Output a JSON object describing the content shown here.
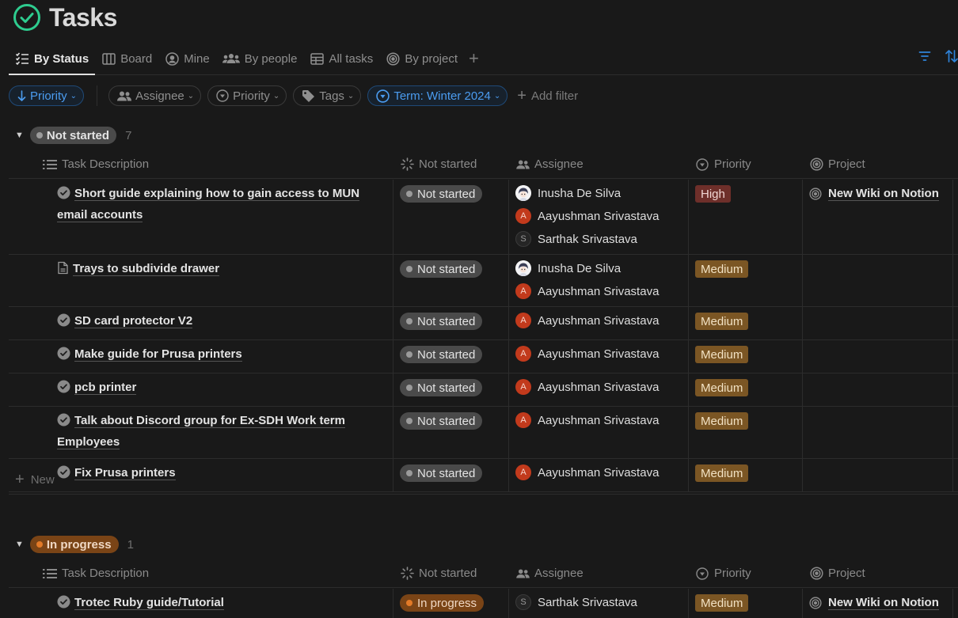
{
  "page": {
    "title": "Tasks",
    "accent": "#2ecc8f"
  },
  "tabs": [
    {
      "label": "By Status",
      "icon": "checklist-icon",
      "active": true
    },
    {
      "label": "Board",
      "icon": "board-icon"
    },
    {
      "label": "Mine",
      "icon": "user-circle-icon"
    },
    {
      "label": "By people",
      "icon": "people-icon"
    },
    {
      "label": "All tasks",
      "icon": "table-icon"
    },
    {
      "label": "By project",
      "icon": "target-icon"
    }
  ],
  "toolbar": {
    "add_view": "+",
    "filter_icon": "filter-icon",
    "sort_icon": "sort-icon"
  },
  "filters": {
    "sort": "Priority",
    "chips": [
      "Assignee",
      "Priority",
      "Tags"
    ],
    "term": "Term: Winter 2024",
    "add_filter": "Add filter"
  },
  "columns": {
    "task": "Task Description",
    "status": "Not started",
    "assignee": "Assignee",
    "priority": "Priority",
    "project": "Project"
  },
  "groups": [
    {
      "label": "Not started",
      "count": "7",
      "rows": [
        {
          "title": "Short guide explaining how to gain access to MUN email accounts",
          "icon": "task-check-icon",
          "status": "Not started",
          "assignees": [
            "Inusha De Silva",
            "Aayushman Srivastava",
            "Sarthak Srivastava"
          ],
          "priority": "High",
          "project": "New Wiki on Notion"
        },
        {
          "title": "Trays to subdivide drawer",
          "icon": "document-icon",
          "status": "Not started",
          "assignees": [
            "Inusha De Silva",
            "Aayushman Srivastava"
          ],
          "priority": "Medium",
          "project": ""
        },
        {
          "title": "SD card protector V2",
          "icon": "task-check-icon",
          "status": "Not started",
          "assignees": [
            "Aayushman Srivastava"
          ],
          "priority": "Medium",
          "project": ""
        },
        {
          "title": "Make guide for Prusa printers",
          "icon": "task-check-icon",
          "status": "Not started",
          "assignees": [
            "Aayushman Srivastava"
          ],
          "priority": "Medium",
          "project": ""
        },
        {
          "title": "pcb printer",
          "icon": "task-check-icon",
          "status": "Not started",
          "assignees": [
            "Aayushman Srivastava"
          ],
          "priority": "Medium",
          "project": ""
        },
        {
          "title": "Talk about Discord group for Ex-SDH Work term Employees",
          "icon": "task-check-icon",
          "status": "Not started",
          "assignees": [
            "Aayushman Srivastava"
          ],
          "priority": "Medium",
          "project": ""
        },
        {
          "title": "Fix Prusa printers",
          "icon": "task-check-icon",
          "status": "Not started",
          "assignees": [
            "Aayushman Srivastava"
          ],
          "priority": "Medium",
          "project": ""
        }
      ],
      "new_label": "New"
    },
    {
      "label": "In progress",
      "count": "1",
      "rows": [
        {
          "title": "Trotec Ruby guide/Tutorial",
          "icon": "task-check-icon",
          "status": "In progress",
          "assignees": [
            "Sarthak Srivastava"
          ],
          "priority": "Medium",
          "project": "New Wiki on Notion"
        }
      ]
    }
  ],
  "people_initials": {
    "Aayushman Srivastava": "A",
    "Sarthak Srivastava": "S"
  }
}
